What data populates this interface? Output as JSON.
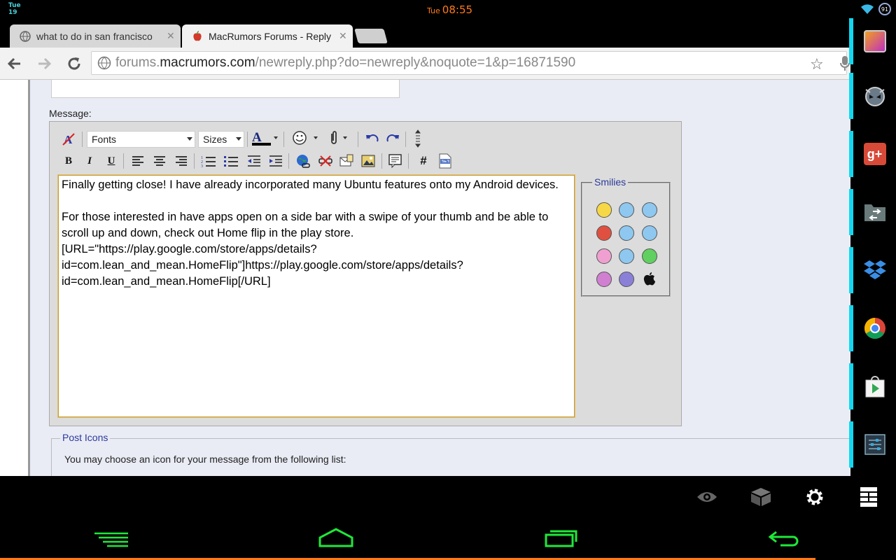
{
  "status_bar": {
    "date_day": "Tue",
    "date_num": "19",
    "clock_day": "Tue",
    "clock_time": "08:55",
    "battery": "91",
    "clock_color": "#ff7a1a"
  },
  "tabs": [
    {
      "label": "what to do in san francisco",
      "close": "✕",
      "favicon": "globe-icon"
    },
    {
      "label": "MacRumors Forums - Reply",
      "close": "✕",
      "favicon": "macrumors-icon"
    }
  ],
  "omnibox": {
    "url_prefix": "forums.",
    "url_host": "macrumors.com",
    "url_path": "/newreply.php?do=newreply&noquote=1&p=16871590"
  },
  "form": {
    "message_label": "Message:",
    "fonts_select": "Fonts",
    "sizes_select": "Sizes",
    "toolbar": {
      "bold": "B",
      "italic": "I",
      "underline": "U",
      "hash": "#"
    },
    "message_lines": [
      "Finally getting close! I have already incorporated many Ubuntu features onto my Android devices.",
      "",
      "For those interested in have apps open on a side bar with a swipe of your thumb and be able to scroll up and down, check out Home flip in the play store.",
      "[URL=\"https://play.google.com/store/apps/details?id=com.lean_and_mean.HomeFlip\"]https://play.google.com/store/apps/details?id=com.lean_and_mean.HomeFlip[/URL]"
    ],
    "smilies_legend": "Smilies",
    "post_icons_legend": "Post Icons",
    "post_icons_desc": "You may choose an icon for your message from the following list:"
  },
  "sidebar_apps": [
    "gallery-icon",
    "alien-icon",
    "google-plus-icon",
    "file-manager-icon",
    "dropbox-icon",
    "chrome-icon",
    "play-store-icon",
    "settings-sliders-icon"
  ],
  "accent_color": "#11d8f0",
  "nav_color": "#1ee83a"
}
